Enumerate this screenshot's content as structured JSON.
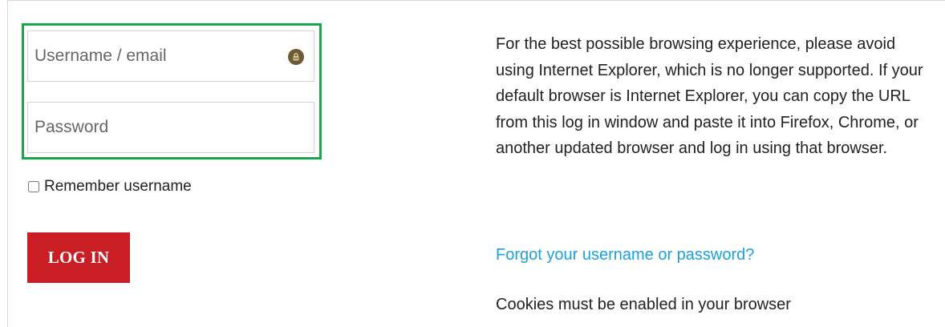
{
  "form": {
    "username_placeholder": "Username / email",
    "password_placeholder": "Password",
    "remember_label": "Remember username",
    "login_label": "LOG IN"
  },
  "info": {
    "message": "For the best possible browsing experience, please avoid using Internet Explorer, which is no longer supported. If your default browser is Internet Explorer, you can copy the URL from this log in window and paste it into Firefox, Chrome, or another updated browser and log in using that browser.",
    "forgot_link": "Forgot your username or password?",
    "cookies_notice": "Cookies must be enabled in your browser"
  },
  "icons": {
    "lock": "lock-icon"
  },
  "colors": {
    "highlight": "#18a84a",
    "button": "#c91f24",
    "link": "#1ba1dd",
    "border": "#d3d3d3"
  }
}
